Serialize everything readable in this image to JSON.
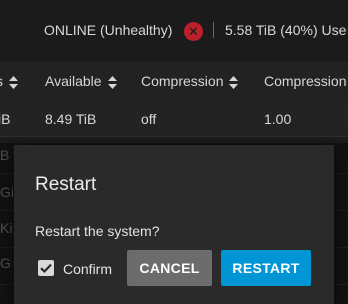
{
  "status": {
    "state": "ONLINE (Unhealthy)",
    "unhealthy_icon": "close-icon",
    "usage": "5.58 TiB (40%) Use"
  },
  "table": {
    "headers": [
      {
        "label": "s",
        "icon": "sort-icon"
      },
      {
        "label": "Available",
        "icon": "sort-icon"
      },
      {
        "label": "Compression",
        "icon": "sort-icon"
      },
      {
        "label": "Compression",
        "icon": ""
      }
    ],
    "rows": [
      {
        "name": "iB",
        "available": "8.49 TiB",
        "compression": "off",
        "ratio": "1.00"
      }
    ],
    "row_fragments": [
      "B",
      "Gi",
      "Ki",
      "G"
    ]
  },
  "dialog": {
    "title": "Restart",
    "message": "Restart the system?",
    "confirm_label": "Confirm",
    "confirm_checked": true,
    "cancel_label": "CANCEL",
    "restart_label": "RESTART"
  },
  "colors": {
    "accent": "#0095d5",
    "danger": "#bd1f2b",
    "dialog_bg": "#2a2a2a"
  }
}
